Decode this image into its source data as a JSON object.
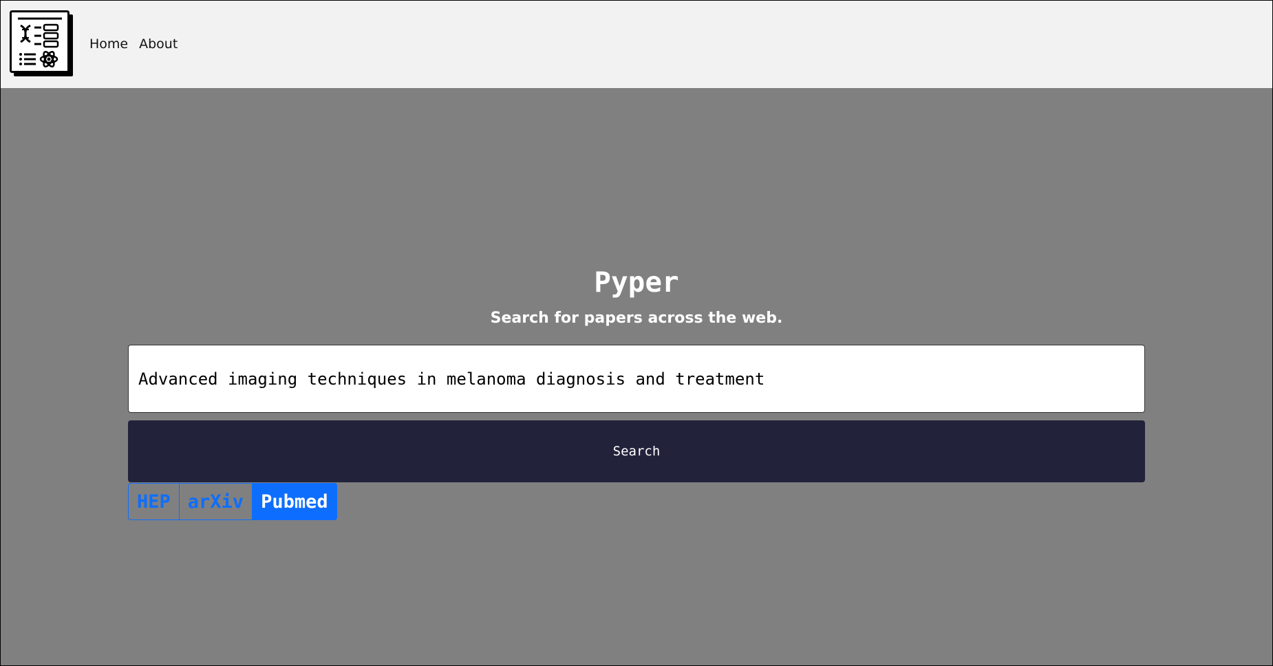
{
  "nav": {
    "logo_icon": "paper-science-logo-icon",
    "links": [
      {
        "label": "Home"
      },
      {
        "label": "About"
      }
    ]
  },
  "hero": {
    "title": "Pyper",
    "subtitle": "Search for papers across the web."
  },
  "search": {
    "value": "Advanced imaging techniques in melanoma diagnosis and treatment",
    "placeholder": "",
    "button_label": "Search"
  },
  "sources": {
    "tabs": [
      {
        "label": "HEP",
        "active": false
      },
      {
        "label": "arXiv",
        "active": false
      },
      {
        "label": "Pubmed",
        "active": true
      }
    ]
  },
  "colors": {
    "background": "#808080",
    "navbar": "#f2f2f2",
    "button": "#22223b",
    "accent": "#0d6efd"
  }
}
